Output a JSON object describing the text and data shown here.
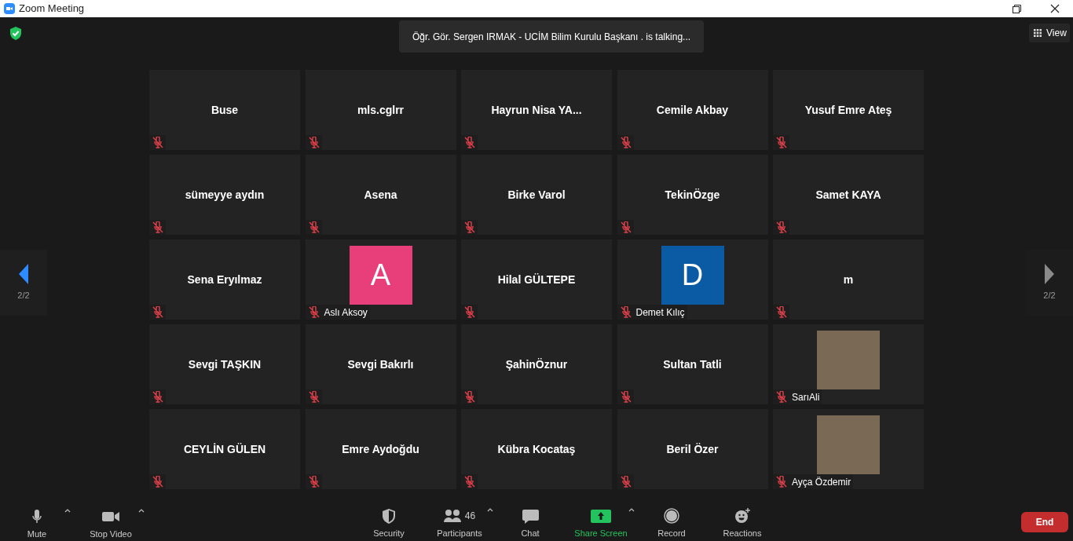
{
  "window": {
    "title": "Zoom Meeting"
  },
  "talking_banner": "Öğr. Gör. Sergen IRMAK - UCİM Bilim Kurulu Başkanı . is talking...",
  "view_button": "View",
  "pager": {
    "prev": {
      "label": "2/2",
      "enabled": true
    },
    "next": {
      "label": "2/2",
      "enabled": false
    }
  },
  "tiles": [
    {
      "kind": "name",
      "name": "Buse",
      "muted": true
    },
    {
      "kind": "name",
      "name": "mls.cglrr",
      "muted": true
    },
    {
      "kind": "name",
      "name": "Hayrun Nisa YA...",
      "muted": true
    },
    {
      "kind": "name",
      "name": "Cemile Akbay",
      "muted": true
    },
    {
      "kind": "name",
      "name": "Yusuf Emre Ateş",
      "muted": true
    },
    {
      "kind": "name",
      "name": "sümeyye aydın",
      "muted": true
    },
    {
      "kind": "name",
      "name": "Asena",
      "muted": true
    },
    {
      "kind": "name",
      "name": "Birke Varol",
      "muted": true
    },
    {
      "kind": "name",
      "name": "TekinÖzge",
      "muted": true
    },
    {
      "kind": "name",
      "name": "Samet KAYA",
      "muted": true
    },
    {
      "kind": "name",
      "name": "Sena Eryılmaz",
      "muted": true
    },
    {
      "kind": "avatar",
      "name": "Aslı Aksoy",
      "initial": "A",
      "color": "#e83e7a",
      "muted": true
    },
    {
      "kind": "name",
      "name": "Hilal GÜLTEPE",
      "muted": true
    },
    {
      "kind": "avatar",
      "name": "Demet Kılıç",
      "initial": "D",
      "color": "#0b5aa4",
      "muted": true
    },
    {
      "kind": "name",
      "name": "m",
      "muted": true
    },
    {
      "kind": "name",
      "name": "Sevgi TAŞKIN",
      "muted": true
    },
    {
      "kind": "name",
      "name": "Sevgi Bakırlı",
      "muted": true
    },
    {
      "kind": "name",
      "name": "ŞahinÖznur",
      "muted": true
    },
    {
      "kind": "name",
      "name": "Sultan Tatli",
      "muted": true
    },
    {
      "kind": "photo",
      "name": "SarıAli",
      "muted": true
    },
    {
      "kind": "name",
      "name": "CEYLİN GÜLEN",
      "muted": true
    },
    {
      "kind": "name",
      "name": "Emre Aydoğdu",
      "muted": true
    },
    {
      "kind": "name",
      "name": "Kübra Kocataş",
      "muted": true
    },
    {
      "kind": "name",
      "name": "Beril Özer",
      "muted": true
    },
    {
      "kind": "photo",
      "name": "Ayça Özdemir",
      "muted": true
    }
  ],
  "toolbar": {
    "left": [
      {
        "kind": "mic",
        "label": "Mute"
      },
      {
        "kind": "video",
        "label": "Stop Video"
      }
    ],
    "center": [
      {
        "kind": "security",
        "label": "Security"
      },
      {
        "kind": "participants",
        "label": "Participants",
        "count": "46"
      },
      {
        "kind": "chat",
        "label": "Chat"
      },
      {
        "kind": "share",
        "label": "Share Screen"
      },
      {
        "kind": "record",
        "label": "Record"
      },
      {
        "kind": "reactions",
        "label": "Reactions"
      }
    ],
    "end_button": "End"
  }
}
